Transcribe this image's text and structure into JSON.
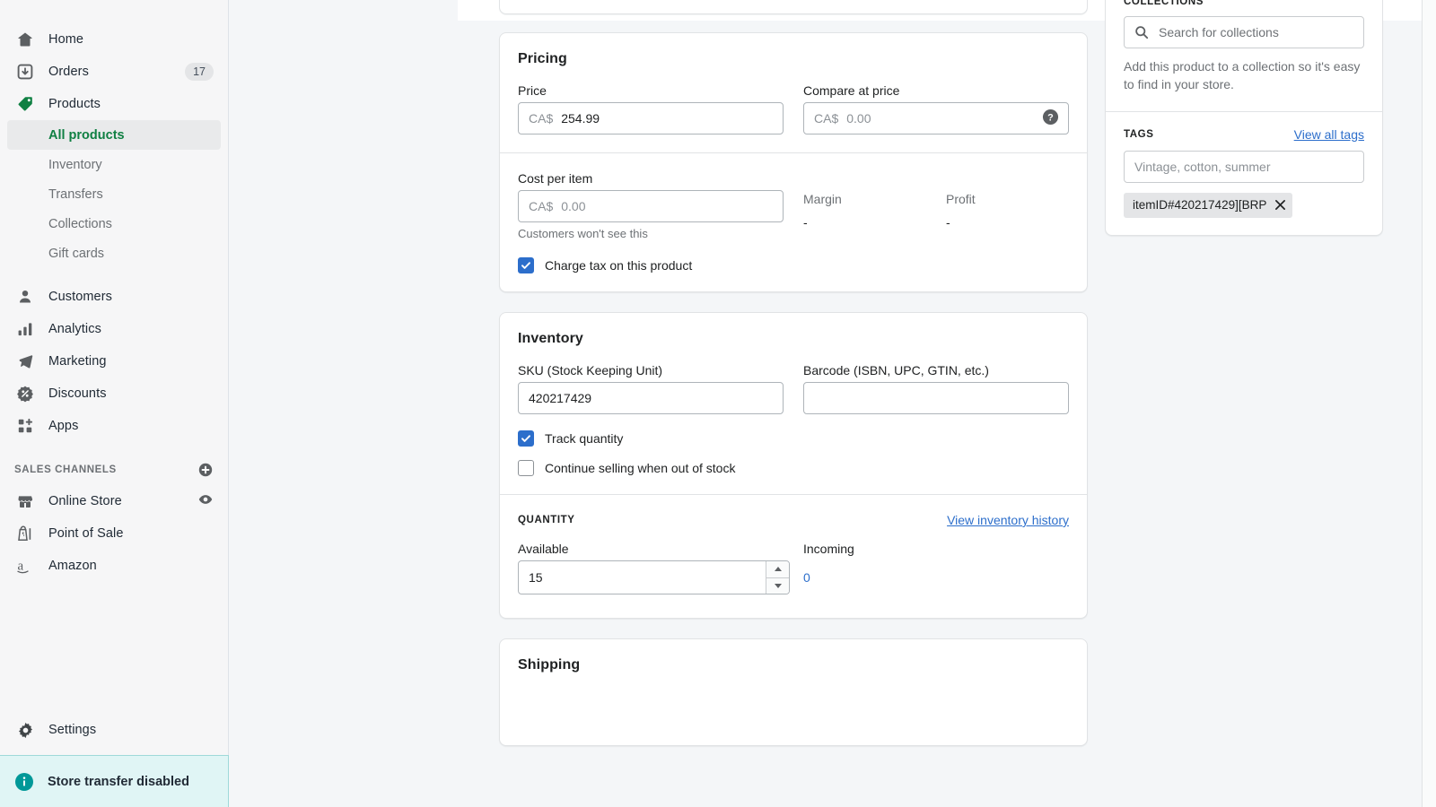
{
  "sidebar": {
    "items": [
      {
        "label": "Home",
        "icon": "home-icon"
      },
      {
        "label": "Orders",
        "icon": "orders-icon",
        "badge": "17"
      },
      {
        "label": "Products",
        "icon": "products-tag-icon"
      }
    ],
    "product_subitems": [
      {
        "label": "All products",
        "active": true
      },
      {
        "label": "Inventory",
        "active": false
      },
      {
        "label": "Transfers",
        "active": false
      },
      {
        "label": "Collections",
        "active": false
      },
      {
        "label": "Gift cards",
        "active": false
      }
    ],
    "items2": [
      {
        "label": "Customers",
        "icon": "customers-icon"
      },
      {
        "label": "Analytics",
        "icon": "analytics-icon"
      },
      {
        "label": "Marketing",
        "icon": "marketing-megaphone-icon"
      },
      {
        "label": "Discounts",
        "icon": "discounts-icon"
      },
      {
        "label": "Apps",
        "icon": "apps-icon"
      }
    ],
    "sales_channels_header": "SALES CHANNELS",
    "sales_channels": [
      {
        "label": "Online Store",
        "icon": "online-store-icon",
        "action_icon": "eye-icon"
      },
      {
        "label": "Point of Sale",
        "icon": "point-of-sale-icon"
      },
      {
        "label": "Amazon",
        "icon": "amazon-icon"
      }
    ],
    "settings": {
      "label": "Settings",
      "icon": "gear-icon"
    },
    "banner": {
      "label": "Store transfer disabled",
      "icon": "info-icon",
      "accent": "#007b7b"
    }
  },
  "pricing": {
    "title": "Pricing",
    "price_label": "Price",
    "price_prefix": "CA$",
    "price_value": "254.99",
    "compare_label": "Compare at price",
    "compare_prefix": "CA$",
    "compare_placeholder": "0.00",
    "compare_help_icon": "help-circle-icon",
    "cost_label": "Cost per item",
    "cost_prefix": "CA$",
    "cost_placeholder": "0.00",
    "cost_helper": "Customers won't see this",
    "margin_label": "Margin",
    "margin_value": "-",
    "profit_label": "Profit",
    "profit_value": "-",
    "tax_checkbox_label": "Charge tax on this product",
    "tax_checked": true
  },
  "inventory": {
    "title": "Inventory",
    "sku_label": "SKU (Stock Keeping Unit)",
    "sku_value": "420217429",
    "barcode_label": "Barcode (ISBN, UPC, GTIN, etc.)",
    "barcode_value": "",
    "track_quantity_label": "Track quantity",
    "track_quantity_checked": true,
    "continue_selling_label": "Continue selling when out of stock",
    "continue_selling_checked": false,
    "quantity_header": "QUANTITY",
    "inventory_history_link": "View inventory history",
    "available_label": "Available",
    "available_value": "15",
    "incoming_label": "Incoming",
    "incoming_value": "0"
  },
  "shipping": {
    "title": "Shipping"
  },
  "collections": {
    "header": "COLLECTIONS",
    "search_placeholder": "Search for collections",
    "search_icon": "search-icon",
    "description": "Add this product to a collection so it's easy to find in your store."
  },
  "tags": {
    "header": "TAGS",
    "view_all_link": "View all tags",
    "input_placeholder": "Vintage, cotton, summer",
    "chips": [
      {
        "label": "itemID#420217429][BRP",
        "remove_icon": "close-icon"
      }
    ]
  },
  "colors": {
    "accent_green": "#108043",
    "link_blue": "#2c6ecb",
    "checkbox_blue": "#2c6ecb",
    "page_bg": "#f4f6f8",
    "sidebar_bg": "#f6f6f7",
    "banner_bg": "#e0f5f5"
  }
}
